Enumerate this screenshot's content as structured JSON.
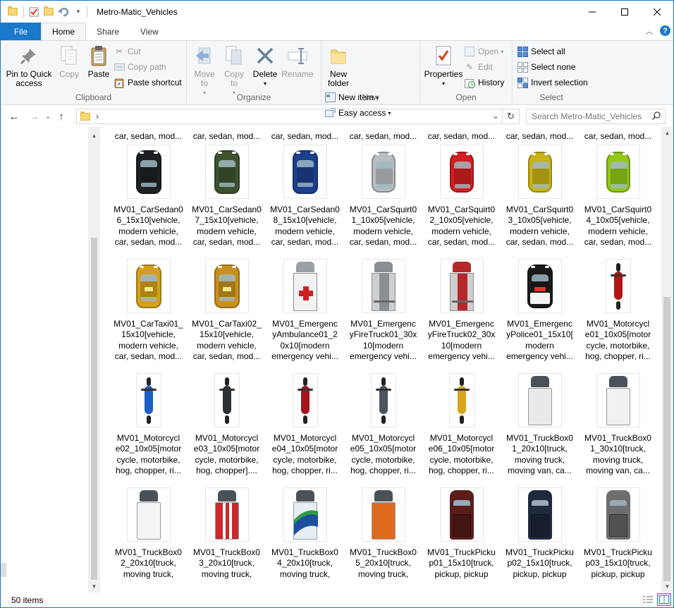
{
  "window": {
    "title": "Metro-Matic_Vehicles"
  },
  "ribbon_tabs": [
    {
      "label": "File"
    },
    {
      "label": "Home"
    },
    {
      "label": "Share"
    },
    {
      "label": "View"
    }
  ],
  "ribbon": {
    "clipboard": {
      "label": "Clipboard",
      "pin": "Pin to Quick access",
      "copy": "Copy",
      "paste": "Paste",
      "cut": "Cut",
      "copy_path": "Copy path",
      "paste_shortcut": "Paste shortcut"
    },
    "organize": {
      "label": "Organize",
      "move_to": "Move to",
      "copy_to": "Copy to",
      "delete": "Delete",
      "rename": "Rename"
    },
    "new": {
      "label": "New",
      "new_folder": "New folder",
      "new_item": "New item",
      "easy_access": "Easy access"
    },
    "open": {
      "label": "Open",
      "properties": "Properties",
      "open": "Open",
      "edit": "Edit",
      "history": "History"
    },
    "select": {
      "label": "Select",
      "select_all": "Select all",
      "select_none": "Select none",
      "invert": "Invert selection"
    }
  },
  "address": {
    "path_chevron": "›",
    "search_placeholder": "Search Metro-Matic_Vehicles"
  },
  "top_partial_labels": [
    "car, sedan, mod...",
    "car, sedan, mod...",
    "car, sedan, mod...",
    "car, sedan, mod...",
    "car, sedan, mod...",
    "car, sedan, mod...",
    "car, sedan, mod..."
  ],
  "rows": [
    [
      {
        "label": "MV01_CarSedan0\n6_15x10[vehicle,\nmodern vehicle,\ncar, sedan, mod...",
        "type": "car",
        "color": "#1e2124"
      },
      {
        "label": "MV01_CarSedan0\n7_15x10[vehicle,\nmodern vehicle,\ncar, sedan, mod...",
        "type": "car",
        "color": "#3f5230"
      },
      {
        "label": "MV01_CarSedan0\n8_15x10[vehicle,\nmodern vehicle,\ncar, sedan, mod...",
        "type": "car",
        "color": "#1d3f8c"
      },
      {
        "label": "MV01_CarSquirt0\n1_10x05[vehicle,\nmodern vehicle,\ncar, sedan, mod...",
        "type": "squirt",
        "color": "#b9bcc0"
      },
      {
        "label": "MV01_CarSquirt0\n2_10x05[vehicle,\nmodern vehicle,\ncar, sedan, mod...",
        "type": "squirt",
        "color": "#d11f22"
      },
      {
        "label": "MV01_CarSquirt0\n3_10x05[vehicle,\nmodern vehicle,\ncar, sedan, mod...",
        "type": "squirt",
        "color": "#c8b418"
      },
      {
        "label": "MV01_CarSquirt0\n4_10x05[vehicle,\nmodern vehicle,\ncar, sedan, mod...",
        "type": "squirt",
        "color": "#92c81a"
      }
    ],
    [
      {
        "label": "MV01_CarTaxi01_\n15x10[vehicle,\nmodern vehicle,\ncar, sedan, mod...",
        "type": "taxi",
        "color": "#d4a01c"
      },
      {
        "label": "MV01_CarTaxi02_\n15x10[vehicle,\nmodern vehicle,\ncar, sedan, mod...",
        "type": "taxi",
        "color": "#c98f1f"
      },
      {
        "label": "MV01_Emergenc\nyAmbulance01_2\n0x10[modern\nemergency vehi...",
        "type": "ambulance",
        "color": "#f2f2f2"
      },
      {
        "label": "MV01_Emergenc\nyFireTruck01_30x\n10[modern\nemergency vehi...",
        "type": "firetruck",
        "color": "#8a8f94"
      },
      {
        "label": "MV01_Emergenc\nyFireTruck02_30x\n10[modern\nemergency vehi...",
        "type": "firetruck",
        "color": "#b4282c"
      },
      {
        "label": "MV01_Emergenc\nyPolice01_15x10[\nmodern\nemergency vehi...",
        "type": "police",
        "color": "#1a1a1a"
      },
      {
        "label": "MV01_Motorcycl\ne01_10x05[motor\ncycle, motorbike,\nhog, chopper, ri...",
        "type": "moto",
        "color": "#b3141a"
      }
    ],
    [
      {
        "label": "MV01_Motorcycl\ne02_10x05[motor\ncycle, motorbike,\nhog, chopper, ri...",
        "type": "moto",
        "color": "#1d5fc4"
      },
      {
        "label": "MV01_Motorcycl\ne03_10x05[motor\ncycle, motorbike,\nhog, chopper]....",
        "type": "moto",
        "color": "#2c2f33"
      },
      {
        "label": "MV01_Motorcycl\ne04_10x05[motor\ncycle, motorbike,\nhog, chopper, ri...",
        "type": "moto",
        "color": "#a3151c"
      },
      {
        "label": "MV01_Motorcycl\ne05_10x05[motor\ncycle, motorbike,\nhog, chopper, ri...",
        "type": "moto",
        "color": "#4a545e"
      },
      {
        "label": "MV01_Motorcycl\ne06_10x05[motor\ncycle, motorbike,\nhog, chopper, ri...",
        "type": "moto",
        "color": "#d9a51e"
      },
      {
        "label": "MV01_TruckBox0\n1_20x10[truck,\nmoving truck,\nmoving van, ca...",
        "type": "truckbox",
        "color": "#e9e9e9"
      },
      {
        "label": "MV01_TruckBox0\n1_30x10[truck,\nmoving truck,\nmoving van, ca...",
        "type": "truckbox",
        "color": "#f1f1f1"
      }
    ],
    [
      {
        "label": "MV01_TruckBox0\n2_20x10[truck,\nmoving truck,\n",
        "type": "truckbox",
        "color": "#f4f4f4"
      },
      {
        "label": "MV01_TruckBox0\n3_20x10[truck,\nmoving truck,\n",
        "type": "truckstripe",
        "color": "#c9282c"
      },
      {
        "label": "MV01_TruckBox0\n4_20x10[truck,\nmoving truck,\n",
        "type": "truckwave",
        "color": "#e8eef2"
      },
      {
        "label": "MV01_TruckBox0\n5_20x10[truck,\nmoving truck,\n",
        "type": "truckbox",
        "color": "#e06a1f"
      },
      {
        "label": "MV01_TruckPicku\np01_15x10[truck,\npickup, pickup\n",
        "type": "pickup",
        "color": "#5a1d1a"
      },
      {
        "label": "MV01_TruckPicku\np02_15x10[truck,\npickup, pickup\n",
        "type": "pickup",
        "color": "#1f2a3f"
      },
      {
        "label": "MV01_TruckPicku\np03_15x10[truck,\npickup, pickup\n",
        "type": "pickup",
        "color": "#6e6e70"
      }
    ]
  ],
  "status": {
    "item_count": "50 items"
  }
}
